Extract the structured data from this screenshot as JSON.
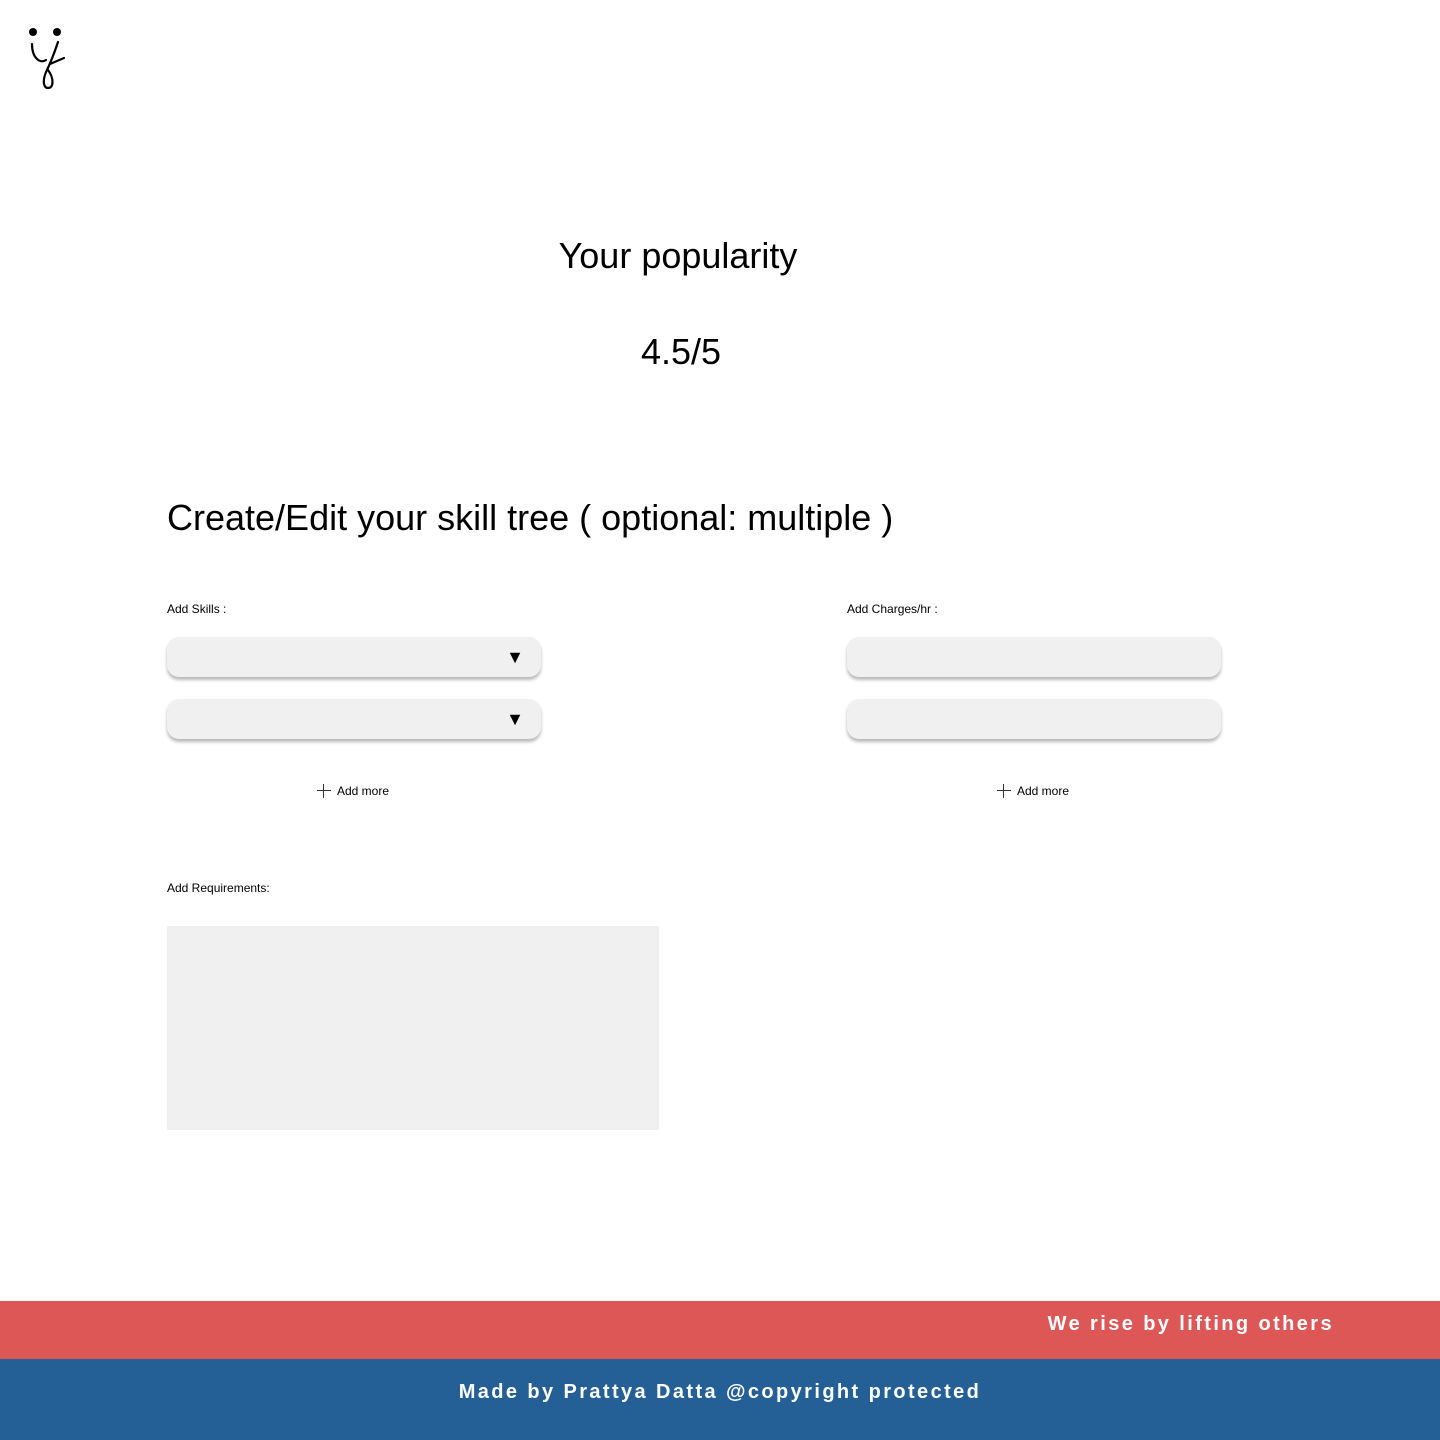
{
  "header": {
    "logo_icon": "smiley-y-logo-icon"
  },
  "popularity": {
    "title": "Your popularity",
    "score": "4.5/5"
  },
  "skill_tree": {
    "title": "Create/Edit your skill tree ( optional: multiple )",
    "skills_label": "Add Skills :",
    "charges_label": "Add Charges/hr :",
    "dropdown_arrow": "▼",
    "skill_dropdowns": [
      "",
      ""
    ],
    "charge_fields": [
      "",
      ""
    ],
    "add_more_label": "Add more",
    "plus_icon": "plus-icon"
  },
  "requirements": {
    "label": "Add Requirements:",
    "value": ""
  },
  "footer": {
    "tagline": "We rise by lifting others",
    "credit": "Made by Prattya Datta @copyright protected",
    "colors": {
      "tagline_bg": "#dd5757",
      "credit_bg": "#245f96",
      "text": "#ffffff"
    }
  }
}
